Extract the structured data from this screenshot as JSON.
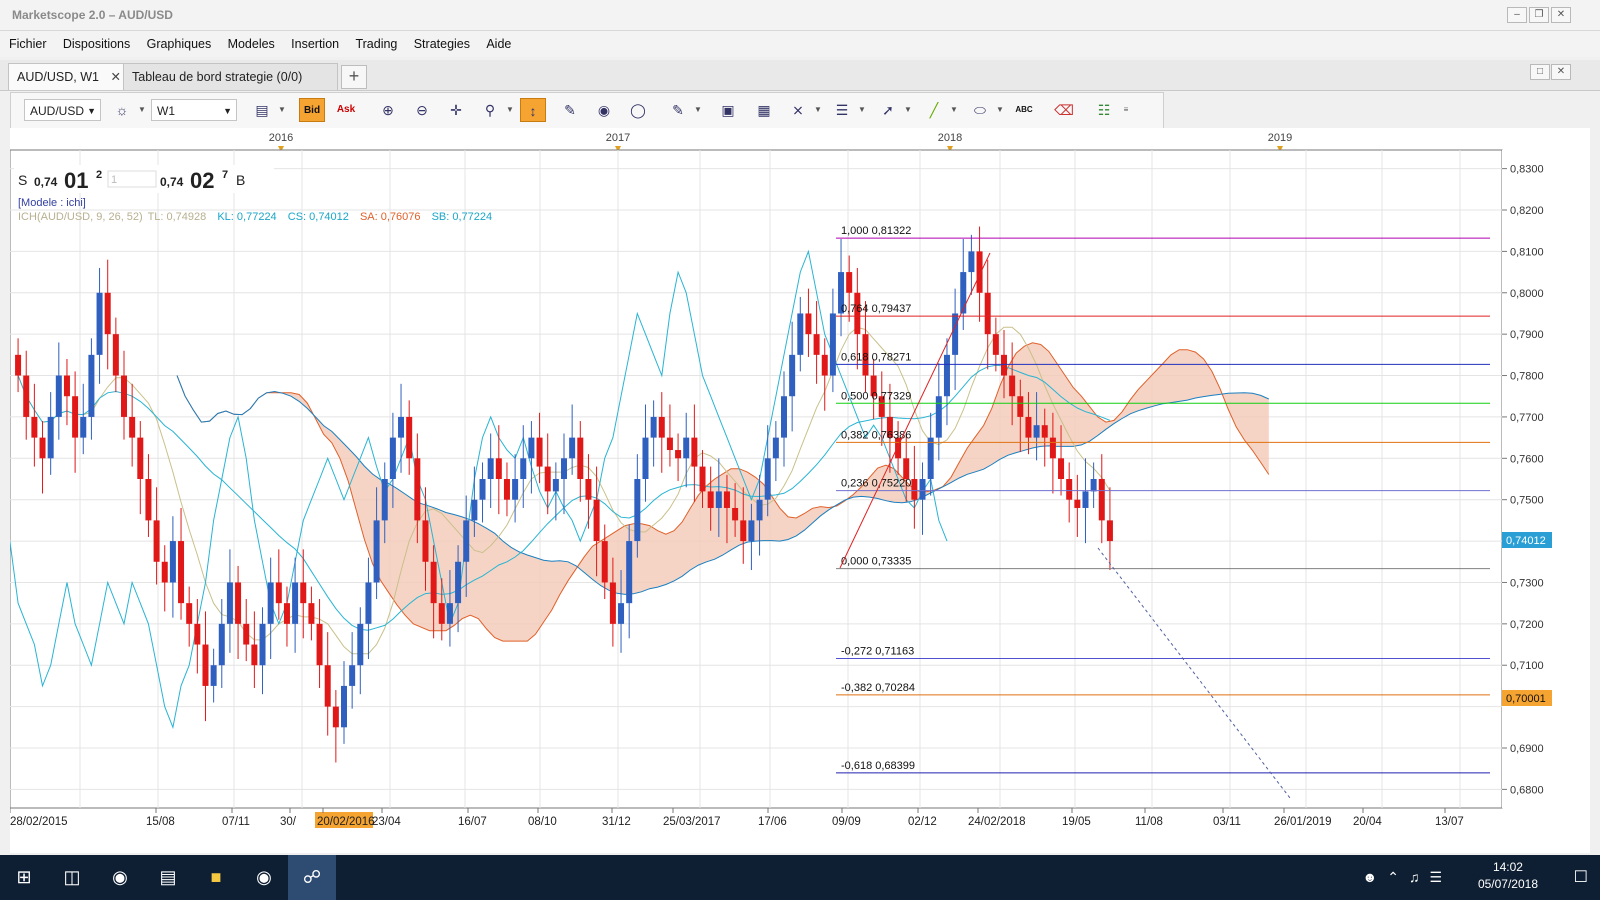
{
  "window": {
    "title": "Marketscope 2.0 – AUD/USD"
  },
  "menu": [
    "Fichier",
    "Dispositions",
    "Graphiques",
    "Modeles",
    "Insertion",
    "Trading",
    "Strategies",
    "Aide"
  ],
  "tabs": {
    "active_label": "AUD/USD, W1",
    "second_label": "Tableau de bord strategie (0/0)",
    "add_label": "+"
  },
  "toolbar": {
    "instrument": "AUD/USD",
    "timeframe": "W1",
    "bid_label": "Bid",
    "ask_label": "Ask",
    "text_tool_label": "ABC"
  },
  "quote": {
    "sell_letter": "S",
    "sell_prefix": "0,74",
    "sell_big": "01",
    "sell_pip": "2",
    "amount": "1",
    "buy_prefix": "0,74",
    "buy_big": "02",
    "buy_pip": "7",
    "buy_letter": "B"
  },
  "legend": {
    "model": "[Modele : ichi]",
    "ich_name": "ICH(AUD/USD, 9, 26, 52)",
    "tl": "TL: 0,74928",
    "kl": "KL: 0,77224",
    "cs": "CS: 0,74012",
    "sa": "SA: 0,76076",
    "sb": "SB: 0,77224"
  },
  "top_axis": [
    "2016",
    "2017",
    "2018",
    "2019"
  ],
  "bottom_axis": [
    "28/02/2015",
    "15/08",
    "07/11",
    "30/",
    "20/02/2016",
    "23/04",
    "16/07",
    "08/10",
    "31/12",
    "25/03/2017",
    "17/06",
    "09/09",
    "02/12",
    "24/02/2018",
    "19/05",
    "11/08",
    "03/11",
    "26/01/2019",
    "20/04",
    "13/07"
  ],
  "price_axis": [
    "0,8300",
    "0,8200",
    "0,8100",
    "0,8000",
    "0,7900",
    "0,7800",
    "0,7700",
    "0,7600",
    "0,7500",
    "0,7300",
    "0,7200",
    "0,7100",
    "0,6900",
    "0,6800"
  ],
  "price_markers": {
    "current": "0,74012",
    "highlight": "0,70001"
  },
  "fibonacci": [
    {
      "label": "1,000 0,81322",
      "price": 0.81322,
      "color": "#b000b0"
    },
    {
      "label": "0,764 0,79437",
      "price": 0.79437,
      "color": "#e02020"
    },
    {
      "label": "0,618 0,78271",
      "price": 0.78271,
      "color": "#2030c0"
    },
    {
      "label": "0,500 0,77329",
      "price": 0.77329,
      "color": "#10d010"
    },
    {
      "label": "0,382 0,76386",
      "price": 0.76386,
      "color": "#e07010"
    },
    {
      "label": "0,236 0,75220",
      "price": 0.7522,
      "color": "#7070d0"
    },
    {
      "label": "0,000 0,73335",
      "price": 0.73335,
      "color": "#808080"
    },
    {
      "label": "-0,272 0,71163",
      "price": 0.71163,
      "color": "#5050d0"
    },
    {
      "label": "-0,382 0,70284",
      "price": 0.70284,
      "color": "#e07010"
    },
    {
      "label": "-0,618 0,68399",
      "price": 0.68399,
      "color": "#2020b0"
    }
  ],
  "chart_data": {
    "type": "candlestick",
    "instrument": "AUD/USD",
    "timeframe": "W1",
    "ylim": [
      0.6755,
      0.8345
    ],
    "closes_approx": [
      0.78,
      0.77,
      0.765,
      0.76,
      0.77,
      0.78,
      0.775,
      0.765,
      0.77,
      0.785,
      0.8,
      0.79,
      0.78,
      0.77,
      0.765,
      0.755,
      0.745,
      0.735,
      0.73,
      0.74,
      0.725,
      0.72,
      0.715,
      0.705,
      0.71,
      0.72,
      0.73,
      0.72,
      0.715,
      0.71,
      0.72,
      0.73,
      0.725,
      0.72,
      0.73,
      0.725,
      0.72,
      0.71,
      0.7,
      0.695,
      0.705,
      0.71,
      0.72,
      0.73,
      0.745,
      0.755,
      0.765,
      0.77,
      0.76,
      0.745,
      0.735,
      0.725,
      0.72,
      0.725,
      0.735,
      0.745,
      0.75,
      0.755,
      0.76,
      0.755,
      0.75,
      0.755,
      0.76,
      0.765,
      0.758,
      0.752,
      0.755,
      0.76,
      0.765,
      0.755,
      0.75,
      0.74,
      0.73,
      0.72,
      0.725,
      0.74,
      0.755,
      0.765,
      0.77,
      0.765,
      0.762,
      0.76,
      0.765,
      0.758,
      0.752,
      0.748,
      0.752,
      0.748,
      0.745,
      0.74,
      0.745,
      0.75,
      0.76,
      0.765,
      0.775,
      0.785,
      0.795,
      0.79,
      0.785,
      0.78,
      0.795,
      0.805,
      0.8,
      0.79,
      0.78,
      0.775,
      0.77,
      0.765,
      0.76,
      0.755,
      0.75,
      0.755,
      0.765,
      0.775,
      0.785,
      0.795,
      0.805,
      0.81,
      0.8,
      0.79,
      0.785,
      0.78,
      0.775,
      0.77,
      0.765,
      0.768,
      0.765,
      0.76,
      0.755,
      0.75,
      0.748,
      0.752,
      0.755,
      0.745,
      0.74
    ]
  }
}
